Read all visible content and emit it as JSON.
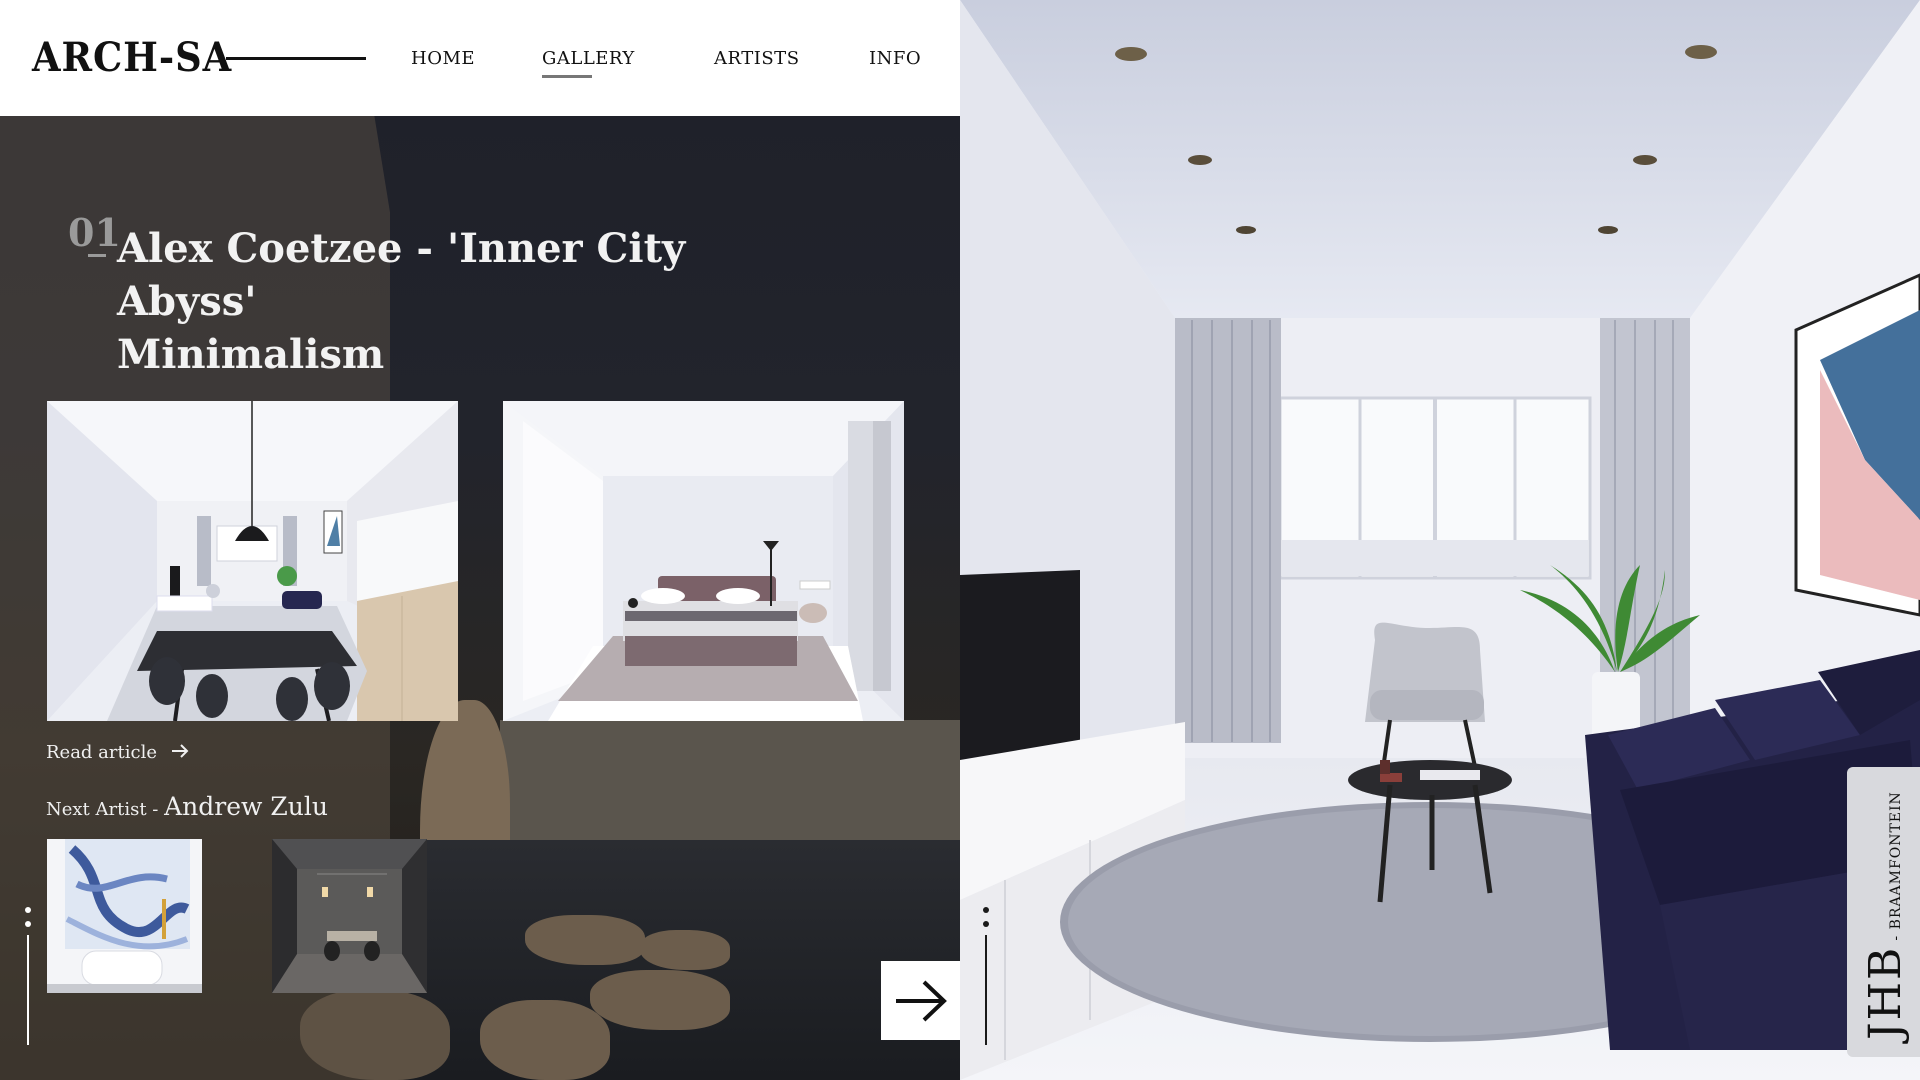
{
  "brand": {
    "logo": "ARCH-SA"
  },
  "nav": {
    "items": [
      {
        "label": "HOME",
        "active": false
      },
      {
        "label": "GALLERY",
        "active": true
      },
      {
        "label": "ARTISTS",
        "active": false
      },
      {
        "label": "INFO",
        "active": false
      }
    ]
  },
  "article": {
    "number": "01",
    "title_line1": "Alex Coetzee - 'Inner City Abyss'",
    "title_line2": "Minimalism",
    "read_label": "Read article",
    "read_icon": "arrow-right-icon"
  },
  "next": {
    "label": "Next Artist - ",
    "name": "Andrew Zulu"
  },
  "next_button": {
    "icon": "arrow-right-icon"
  },
  "location": {
    "city": "JHB",
    "suburb": "- BRAAMFONTEIN"
  },
  "colors": {
    "header_bg": "#ffffff",
    "left_panel_bg": "#22242c",
    "text_light": "#f2f2f2",
    "sofa": "#25244a",
    "room_wall": "#eef0f7"
  }
}
